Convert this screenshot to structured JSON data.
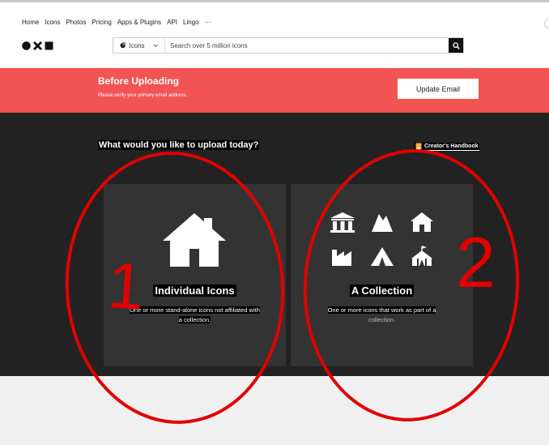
{
  "nav": {
    "items": [
      "Home",
      "Icons",
      "Photos",
      "Pricing",
      "Apps & Plugins",
      "API",
      "Lingo",
      "···"
    ]
  },
  "search": {
    "type_label": "Icons",
    "placeholder": "Search over 5 million icons"
  },
  "banner": {
    "title": "Before Uploading",
    "subtitle": "Please verify your primary email address.",
    "button_label": "Update Email"
  },
  "upload": {
    "question": "What would you like to upload today?",
    "handbook_label": "Creator's Handbook",
    "cards": [
      {
        "title": "Individual Icons",
        "description": "One or more stand-alone icons not affiliated with a collection."
      },
      {
        "title": "A Collection",
        "description": "One or more icons that work as part of a",
        "description_muted": "collection."
      }
    ]
  },
  "annotations": {
    "label_1": "1",
    "label_2": "2",
    "color": "#e00000"
  },
  "colors": {
    "banner": "#f25454",
    "dark_bg": "#222222",
    "card_bg": "#333333"
  }
}
